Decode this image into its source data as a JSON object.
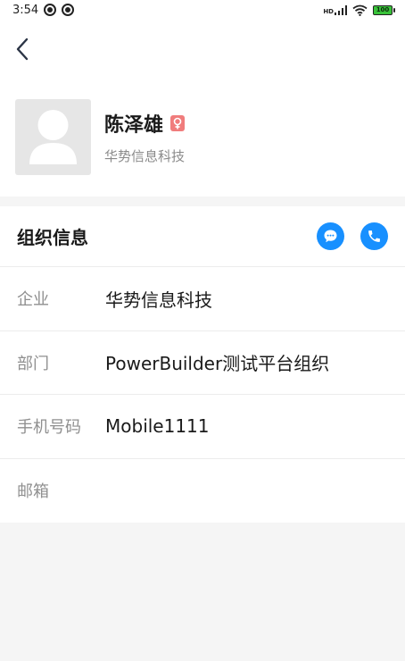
{
  "status_bar": {
    "time": "3:54",
    "network_label": "HD",
    "battery": "100"
  },
  "profile": {
    "name": "陈泽雄",
    "company": "华势信息科技",
    "gender_icon": "female-icon"
  },
  "org": {
    "title": "组织信息",
    "rows": [
      {
        "label": "企业",
        "value": "华势信息科技"
      },
      {
        "label": "部门",
        "value": "PowerBuilder测试平台组织"
      },
      {
        "label": "手机号码",
        "value": "Mobile1111"
      },
      {
        "label": "邮箱",
        "value": ""
      }
    ]
  },
  "colors": {
    "accent": "#1890ff",
    "gender_badge": "#f07c7c",
    "label_gray": "#8f8f8f"
  }
}
